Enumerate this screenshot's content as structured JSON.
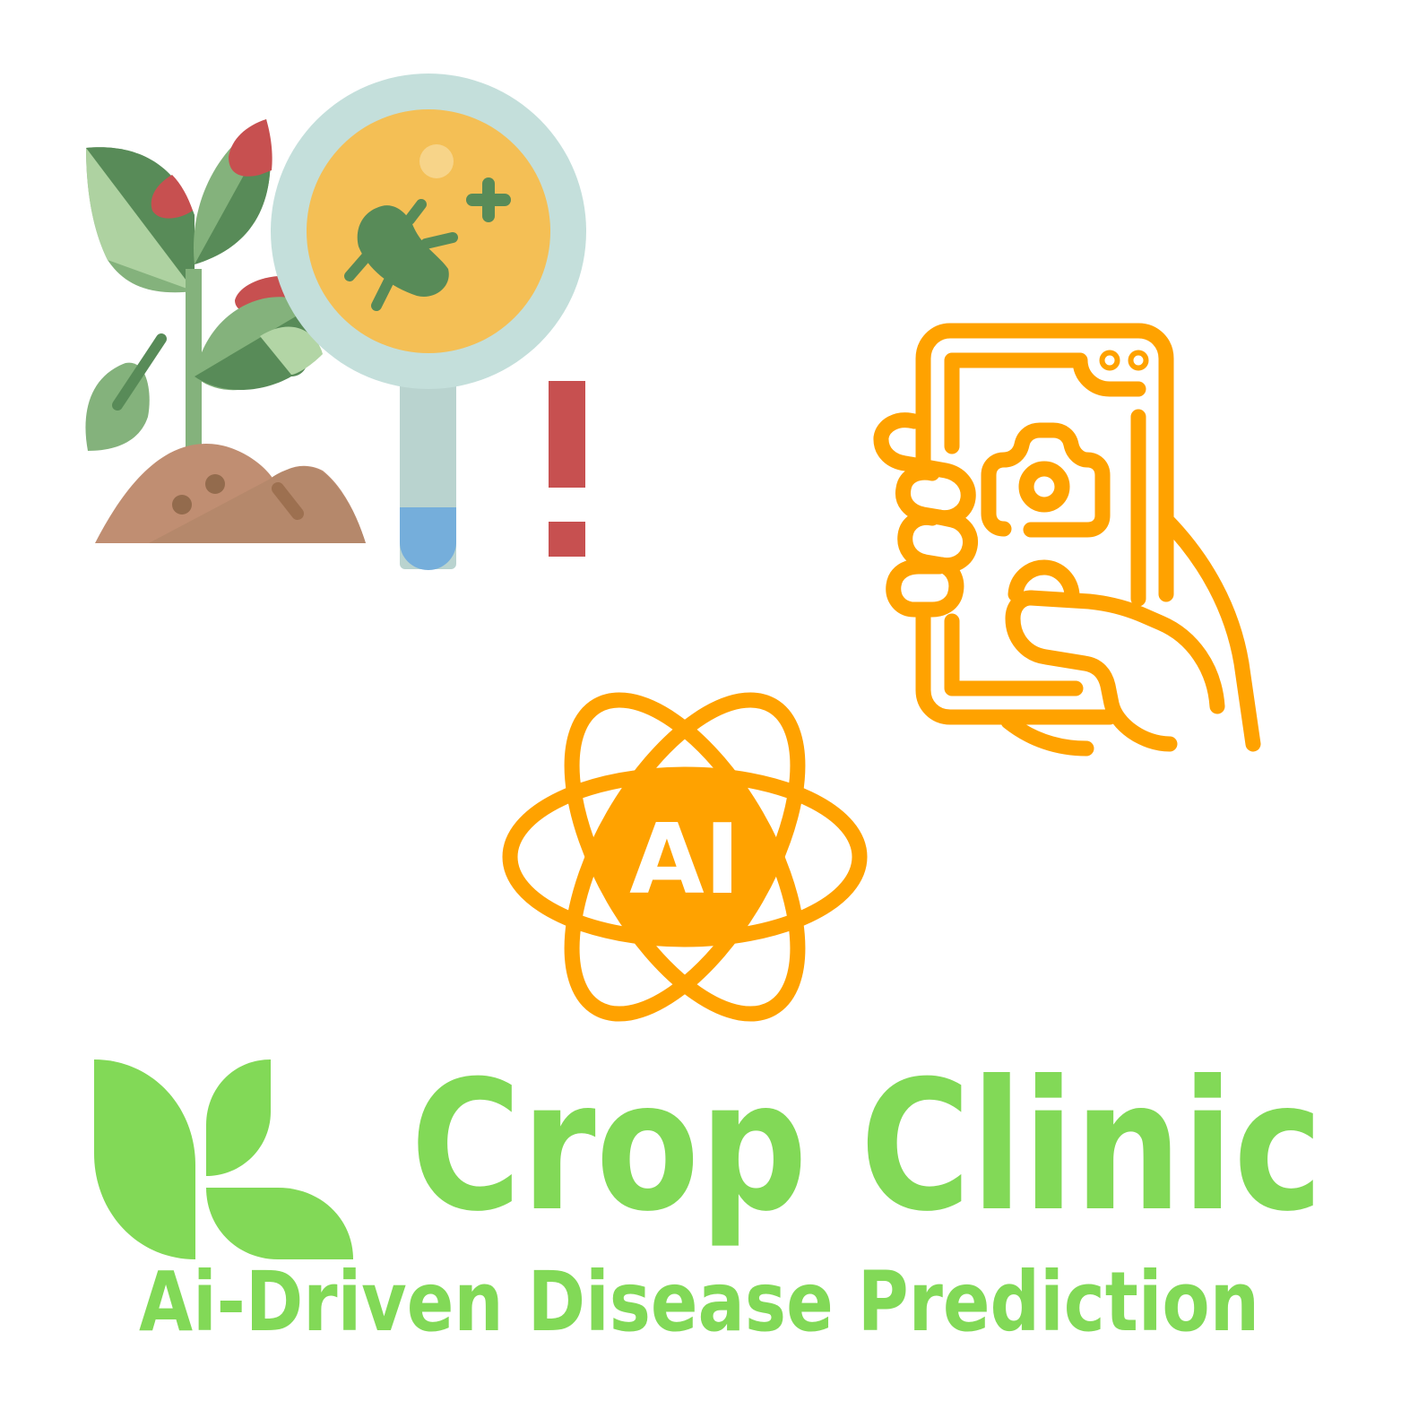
{
  "colors": {
    "brand_green": "#82d957",
    "accent_orange": "#ffa200",
    "leaf_dark": "#588b58",
    "leaf_mid": "#84b27c",
    "leaf_light": "#b2d5a5",
    "berry_red": "#c75050",
    "soil": "#c08e72",
    "soil_dot": "#936b4d",
    "lens_rim": "#c4dfdb",
    "lens_glass": "#f4bf55",
    "handle": "#b9d3cf",
    "handle_tip": "#75aedb"
  },
  "icons": {
    "plant": "plant-disease-magnifier-icon",
    "phone": "hand-phone-camera-icon",
    "ai": "ai-atom-icon",
    "logo": "leaf-logo-icon"
  },
  "ai_badge": {
    "text": "AI"
  },
  "brand": {
    "name": "Crop Clinic",
    "tagline": "Ai-Driven Disease Prediction"
  }
}
